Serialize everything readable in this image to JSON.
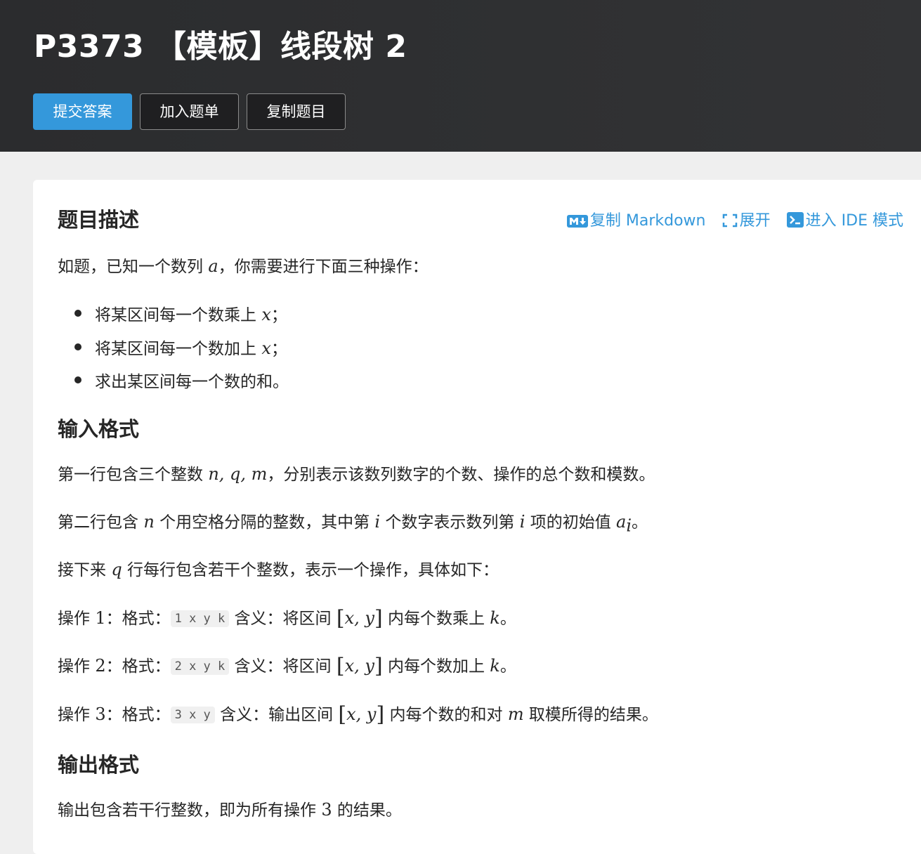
{
  "header": {
    "title": "P3373 【模板】线段树 2",
    "buttons": {
      "submit": "提交答案",
      "add_list": "加入题单",
      "copy_problem": "复制题目"
    }
  },
  "actions": {
    "copy_markdown": "复制 Markdown",
    "expand": "展开",
    "ide_mode": "进入 IDE 模式"
  },
  "sections": {
    "description": {
      "heading": "题目描述",
      "intro_pre": "如题，已知一个数列 ",
      "intro_var": "a",
      "intro_post": "，你需要进行下面三种操作：",
      "items": [
        {
          "pre": "将某区间每一个数乘上 ",
          "var": "x",
          "post": "；"
        },
        {
          "pre": "将某区间每一个数加上 ",
          "var": "x",
          "post": "；"
        },
        {
          "pre": "求出某区间每一个数的和。"
        }
      ]
    },
    "input": {
      "heading": "输入格式",
      "line1_pre": "第一行包含三个整数 ",
      "line1_vars": "n, q, m",
      "line1_post": "，分别表示该数列数字的个数、操作的总个数和模数。",
      "line2_a": "第二行包含 ",
      "line2_n": "n",
      "line2_b": " 个用空格分隔的整数，其中第 ",
      "line2_i": "i",
      "line2_c": " 个数字表示数列第 ",
      "line2_i2": "i",
      "line2_d": " 项的初始值 ",
      "line2_a_var": "a",
      "line2_sub": "i",
      "line2_e": "。",
      "line3_pre": "接下来 ",
      "line3_q": "q",
      "line3_post": " 行每行包含若干个整数，表示一个操作，具体如下：",
      "op1": {
        "label": "操作 ",
        "num": "1",
        "fmt": "：格式：",
        "code": "1 x y k",
        "meaning": " 含义：将区间 ",
        "interval": "x, y",
        "rest": " 内每个数乘上 ",
        "var": "k",
        "end": "。"
      },
      "op2": {
        "label": "操作 ",
        "num": "2",
        "fmt": "：格式：",
        "code": "2 x y k",
        "meaning": " 含义：将区间 ",
        "interval": "x, y",
        "rest": " 内每个数加上 ",
        "var": "k",
        "end": "。"
      },
      "op3": {
        "label": "操作 ",
        "num": "3",
        "fmt": "：格式：",
        "code": "3 x y",
        "meaning": " 含义：输出区间 ",
        "interval": "x, y",
        "rest": " 内每个数的和对 ",
        "var": "m",
        "end": " 取模所得的结果。"
      }
    },
    "output": {
      "heading": "输出格式",
      "line_pre": "输出包含若干行整数，即为所有操作 ",
      "line_num": "3",
      "line_post": " 的结果。"
    }
  },
  "colors": {
    "accent": "#3498db",
    "header_bg": "#2b2c2e",
    "page_bg": "#efefef"
  }
}
